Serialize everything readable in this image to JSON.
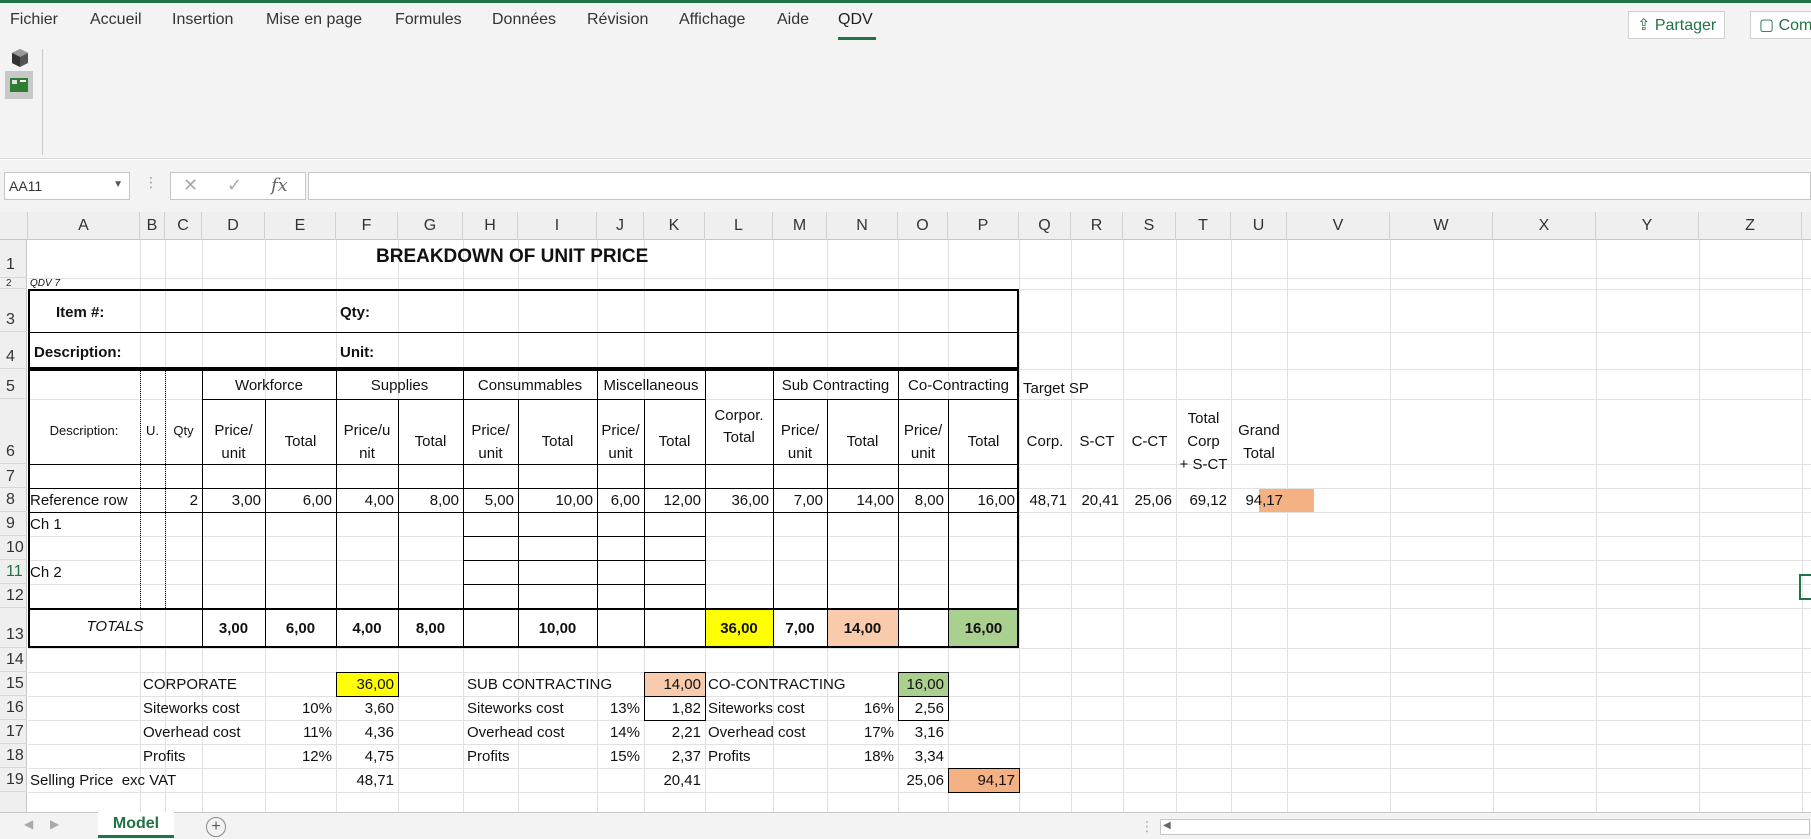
{
  "app": {
    "menu": [
      "Fichier",
      "Accueil",
      "Insertion",
      "Mise en page",
      "Formules",
      "Données",
      "Révision",
      "Affichage",
      "Aide",
      "QDV"
    ],
    "active_menu": "QDV",
    "share_label": "Partager",
    "comments_label": "Com",
    "accent": "#217346"
  },
  "formula_bar": {
    "name_box": "AA11",
    "cancel_icon": "✕",
    "enter_icon": "✓",
    "fx_label": "fx",
    "formula": ""
  },
  "columns": [
    "A",
    "B",
    "C",
    "D",
    "E",
    "F",
    "G",
    "H",
    "I",
    "J",
    "K",
    "L",
    "M",
    "N",
    "O",
    "P",
    "Q",
    "R",
    "S",
    "T",
    "U",
    "V",
    "W",
    "X",
    "Y",
    "Z"
  ],
  "rows": [
    "1",
    "2",
    "3",
    "4",
    "5",
    "6",
    "7",
    "8",
    "9",
    "10",
    "11",
    "12",
    "13",
    "14",
    "15",
    "16",
    "17",
    "18",
    "19"
  ],
  "sheet": {
    "title": "BREAKDOWN OF UNIT PRICE",
    "qdv_tag": "QDV 7",
    "item_label": "Item #:",
    "qty_label": "Qty:",
    "description_label": "Description:",
    "unit_label": "Unit:",
    "header": {
      "description": "Description:",
      "u": "U.",
      "qty": "Qty",
      "workforce": "Workforce",
      "supplies": "Supplies",
      "consumables": "Consummables",
      "misc": "Miscellaneous",
      "corp_total_1": "Corpor.",
      "corp_total_2": "Total",
      "sub_contracting": "Sub Contracting",
      "co_contracting": "Co-Contracting",
      "target_sp": "Target SP",
      "price_unit_a": "Price/",
      "price_unit_b": "unit",
      "price_u_a": "Price/u",
      "price_u_b": "nit",
      "total": "Total",
      "corp": "Corp.",
      "sct": "S-CT",
      "cct": "C-CT",
      "total_corp_1": "Total",
      "total_corp_2": "Corp",
      "total_corp_3": "+ S-CT",
      "grand_total_1": "Grand",
      "grand_total_2": "Total"
    },
    "reference_row": {
      "label": "Reference row",
      "qty": "2",
      "wf_price": "3,00",
      "wf_total": "6,00",
      "sup_price": "4,00",
      "sup_total": "8,00",
      "con_price": "5,00",
      "con_total": "10,00",
      "mis_price": "6,00",
      "mis_total": "12,00",
      "corp_total": "36,00",
      "sub_price": "7,00",
      "sub_total": "14,00",
      "co_price": "8,00",
      "co_total": "16,00",
      "t_corp": "48,71",
      "t_sct": "20,41",
      "t_cct": "25,06",
      "t_corp_sct": "69,12",
      "grand_total": "94,17"
    },
    "ch1": "Ch 1",
    "ch2": "Ch 2",
    "totals": {
      "label": "TOTALS",
      "wf_price": "3,00",
      "wf_total": "6,00",
      "sup_price": "4,00",
      "sup_total": "8,00",
      "con_total": "10,00",
      "corp_total": "36,00",
      "sub_price": "7,00",
      "sub_total": "14,00",
      "co_total": "16,00"
    },
    "summary": {
      "corporate": "CORPORATE",
      "corporate_value": "36,00",
      "siteworks": "Siteworks cost",
      "overhead": "Overhead cost",
      "profits": "Profits",
      "corp_site_pct": "10%",
      "corp_site_val": "3,60",
      "corp_over_pct": "11%",
      "corp_over_val": "4,36",
      "corp_prof_pct": "12%",
      "corp_prof_val": "4,75",
      "sub": "SUB CONTRACTING",
      "sub_value": "14,00",
      "sub_site_pct": "13%",
      "sub_site_val": "1,82",
      "sub_over_pct": "14%",
      "sub_over_val": "2,21",
      "sub_prof_pct": "15%",
      "sub_prof_val": "2,37",
      "co": "CO-CONTRACTING",
      "co_value": "16,00",
      "co_site_pct": "16%",
      "co_site_val": "2,56",
      "co_over_pct": "17%",
      "co_over_val": "3,16",
      "co_prof_pct": "18%",
      "co_prof_val": "3,34",
      "selling_price": "Selling Price  exc VAT",
      "sp_corp": "48,71",
      "sp_sub": "20,41",
      "sp_co": "25,06",
      "sp_grand": "94,17"
    }
  },
  "colors": {
    "yellow": "#ffff00",
    "peach": "#f8cbad",
    "green": "#a9d08e",
    "orange": "#f4b183"
  },
  "tabs": {
    "model": "Model",
    "add": "+"
  }
}
